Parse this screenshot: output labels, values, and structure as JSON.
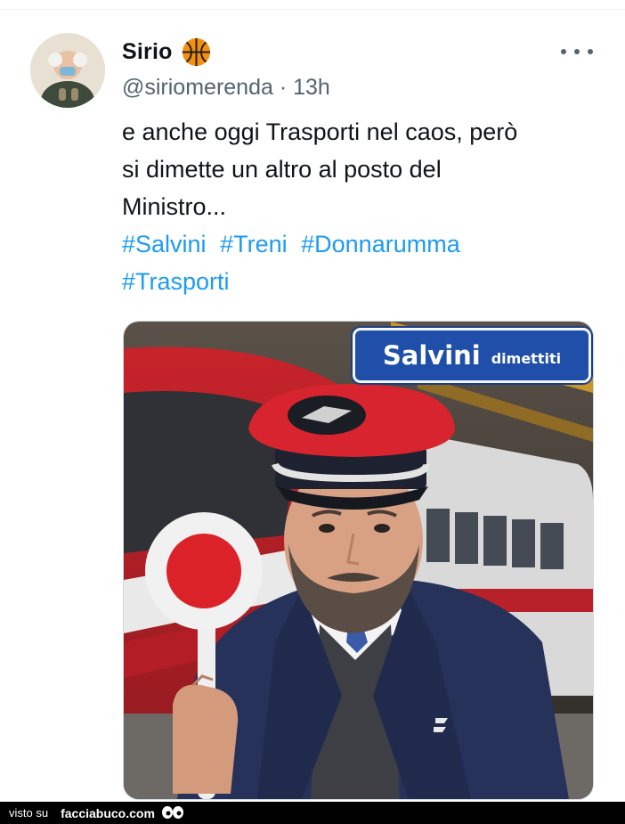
{
  "tweet": {
    "display_name": "Sirio",
    "handle": "@siriomerenda",
    "separator": "·",
    "time": "13h",
    "text_lines": [
      "e anche oggi Trasporti nel caos, però",
      "si dimette un altro al posto del",
      "Ministro..."
    ],
    "hashtags": [
      "#Salvini",
      "#Treni",
      "#Donnarumma",
      "#Trasporti"
    ]
  },
  "media": {
    "sign_main": "Salvini",
    "sign_sub": "dimettiti"
  },
  "footer": {
    "visto_su": "visto su",
    "brand": "facciabuco.com"
  },
  "icons": {
    "badge": "basketball-icon",
    "more": "more-options-icon"
  },
  "colors": {
    "text": "#0f1419",
    "secondary": "#536471",
    "link": "#1d9bf0",
    "badge": "#f4900c"
  }
}
